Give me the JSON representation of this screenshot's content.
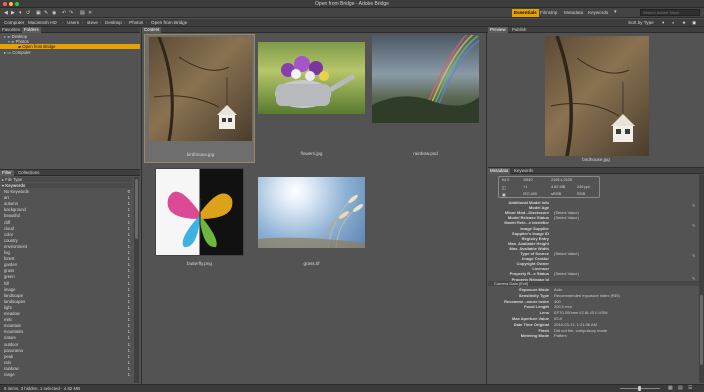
{
  "window": {
    "title": "Open from Bridge - Adobe Bridge"
  },
  "workspaces": [
    "Essentials",
    "Filmstrip",
    "Metadata",
    "Keywords"
  ],
  "search": {
    "sort": "Sort by Type",
    "placeholder": "Search Adobe Stock"
  },
  "breadcrumbs": [
    "Computer",
    "Macintosh HD",
    "Users",
    "steve",
    "Desktop",
    "Photos",
    "Open from Bridge"
  ],
  "left_tabs": [
    "Favorites",
    "Folders"
  ],
  "folders": [
    "Desktop",
    "Photos",
    "Open from Bridge",
    "Computer"
  ],
  "filter_tabs": [
    "Filter",
    "Collections"
  ],
  "filter": {
    "file_type": "File Type",
    "heading": "Keywords",
    "items": [
      {
        "label": "No Keywords",
        "count": "0"
      },
      {
        "label": "art",
        "count": "1"
      },
      {
        "label": "autumn",
        "count": "1"
      },
      {
        "label": "background",
        "count": "1"
      },
      {
        "label": "beautiful",
        "count": "1"
      },
      {
        "label": "cliff",
        "count": "1"
      },
      {
        "label": "cloud",
        "count": "1"
      },
      {
        "label": "color",
        "count": "1"
      },
      {
        "label": "country",
        "count": "1"
      },
      {
        "label": "environment",
        "count": "1"
      },
      {
        "label": "fog",
        "count": "1"
      },
      {
        "label": "forest",
        "count": "1"
      },
      {
        "label": "garden",
        "count": "1"
      },
      {
        "label": "grass",
        "count": "1"
      },
      {
        "label": "green",
        "count": "1"
      },
      {
        "label": "hill",
        "count": "1"
      },
      {
        "label": "image",
        "count": "1"
      },
      {
        "label": "landscape",
        "count": "1"
      },
      {
        "label": "landscapes",
        "count": "1"
      },
      {
        "label": "light",
        "count": "1"
      },
      {
        "label": "meadow",
        "count": "1"
      },
      {
        "label": "mist",
        "count": "1"
      },
      {
        "label": "mountain",
        "count": "1"
      },
      {
        "label": "mountains",
        "count": "1"
      },
      {
        "label": "nature",
        "count": "1"
      },
      {
        "label": "outdoor",
        "count": "1"
      },
      {
        "label": "panorama",
        "count": "1"
      },
      {
        "label": "peak",
        "count": "1"
      },
      {
        "label": "rain",
        "count": "1"
      },
      {
        "label": "rainbow",
        "count": "1"
      },
      {
        "label": "range",
        "count": "1"
      }
    ]
  },
  "content": {
    "tab": "Content",
    "items": [
      {
        "name": "birdhouse.jpg"
      },
      {
        "name": "flowers.jpg"
      },
      {
        "name": "rainbow.psd"
      },
      {
        "name": "butterfly.png"
      },
      {
        "name": "grass.tif"
      }
    ]
  },
  "preview": {
    "tabs": [
      "Preview",
      "Publish"
    ],
    "caption": "birdhouse.jpg"
  },
  "metadata_tabs": [
    "Metadata",
    "Keywords"
  ],
  "metadata_summary": {
    "fstop": "f/4.0",
    "shutter": "1/640",
    "ev": "+1",
    "iso": "ISO 400",
    "dims": "2105 x 2105",
    "size": "4.82 MB",
    "res": "240 ppi",
    "colorspace": "sRGB",
    "mode": "RGB"
  },
  "metadata_rows": [
    {
      "k": "Additional Model Info",
      "v": ""
    },
    {
      "k": "Model Age",
      "v": ""
    },
    {
      "k": "Minor Mod...Disclosure",
      "v": "(Select Value)"
    },
    {
      "k": "Model Release Status",
      "v": "(Select Value)"
    },
    {
      "k": "Model Rele...e Identifier",
      "v": ""
    },
    {
      "k": "Image Supplier",
      "v": ""
    },
    {
      "k": "Supplier's Image ID",
      "v": ""
    },
    {
      "k": "Registry Entry",
      "v": ""
    },
    {
      "k": "Max. Available Height",
      "v": ""
    },
    {
      "k": "Max. Available Width",
      "v": ""
    },
    {
      "k": "Type of Source",
      "v": "(Select Value)"
    },
    {
      "k": "Image Creator",
      "v": ""
    },
    {
      "k": "Copyright Owner",
      "v": ""
    },
    {
      "k": "Licensor",
      "v": ""
    },
    {
      "k": "Property R...e Status",
      "v": "(Select Value)"
    },
    {
      "k": "Property Release Id",
      "v": ""
    }
  ],
  "camera_section": "Camera Data (Exif)",
  "camera_rows": [
    {
      "k": "Exposure Mode",
      "v": "Auto"
    },
    {
      "k": "Sensitivity Type",
      "v": "Recommended exposure index (REI)"
    },
    {
      "k": "Recomme...osure Index",
      "v": "400"
    },
    {
      "k": "Focal Length",
      "v": "200.0 mm"
    },
    {
      "k": "Lens",
      "v": "EF70-200mm f/2.8L IS II USM"
    },
    {
      "k": "Max Aperture Value",
      "v": "f/2.8"
    },
    {
      "k": "Date Time Original",
      "v": "2016-03-13, 1:21:06 AM"
    },
    {
      "k": "Flash",
      "v": "Did not fire, compulsory mode"
    },
    {
      "k": "Metering Mode",
      "v": "Pattern"
    }
  ],
  "status": "5 items, 3 hidden, 1 selected - 4.82 MB"
}
